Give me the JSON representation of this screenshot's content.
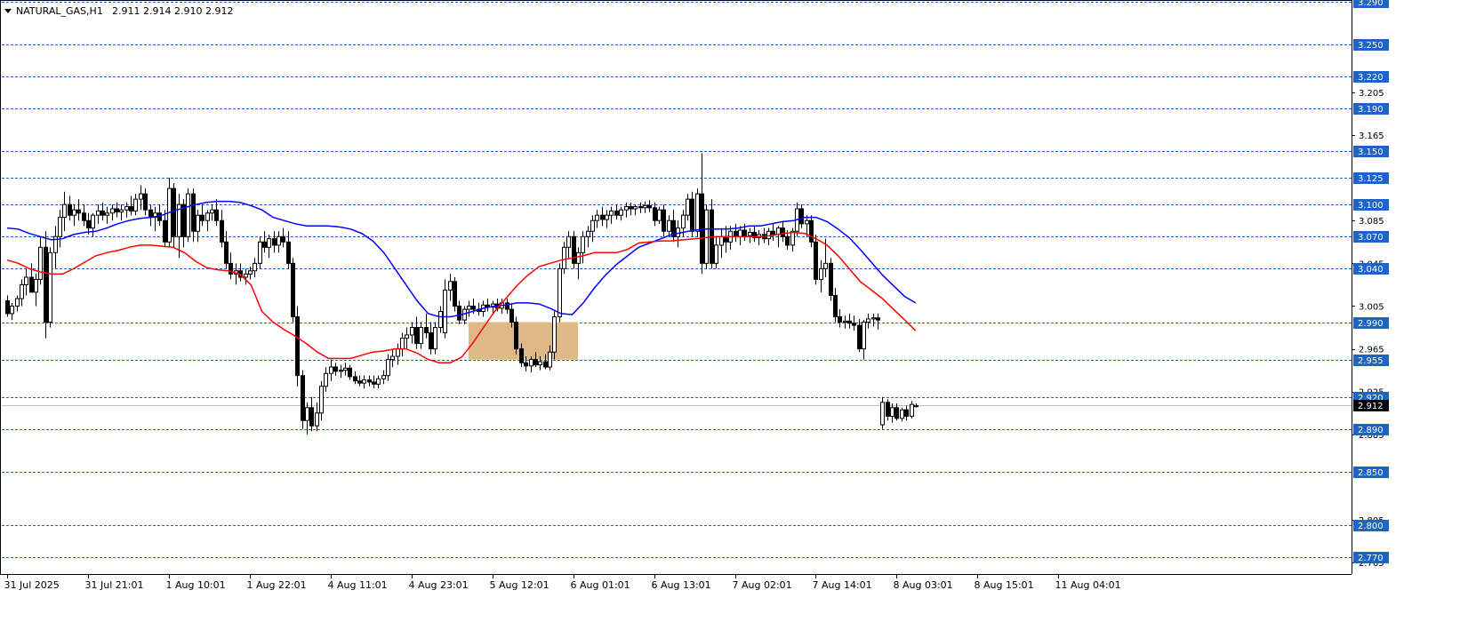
{
  "chart_data": {
    "type": "candlestick",
    "header": {
      "symbol": "NATURAL_GAS,H1",
      "ohlc": "2.911 2.914 2.910 2.912"
    },
    "y_axis": {
      "range": [
        2.7544,
        3.2913
      ],
      "scale_labels": [
        "3.205",
        "3.165",
        "3.085",
        "3.045",
        "3.005",
        "2.965",
        "2.925",
        "2.885",
        "2.805",
        "2.765"
      ],
      "levels": [
        "3.290",
        "3.250",
        "3.220",
        "3.190",
        "3.150",
        "3.125",
        "3.100",
        "3.070",
        "3.040",
        "2.990",
        "2.955",
        "2.920",
        "2.890",
        "2.850",
        "2.800",
        "2.770"
      ],
      "current_price": "2.912"
    },
    "x_axis": {
      "labels": [
        "31 Jul 2025",
        "31 Jul 21:01",
        "1 Aug 10:01",
        "1 Aug 22:01",
        "4 Aug 11:01",
        "4 Aug 23:01",
        "5 Aug 12:01",
        "6 Aug 01:01",
        "6 Aug 13:01",
        "7 Aug 02:01",
        "7 Aug 14:01",
        "8 Aug 03:01",
        "8 Aug 15:01",
        "11 Aug 04:01"
      ]
    },
    "zone": {
      "from_bar": 97,
      "to_bar": 120,
      "low": 2.955,
      "high": 2.99,
      "color": "#deb887"
    },
    "colors": {
      "fast_ma": "#0000ff",
      "slow_ma": "#ff0000",
      "level_line": "#1e63c8",
      "bull": "#ffffff",
      "bear": "#000000"
    },
    "ohlc": [
      [
        3.01,
        3.015,
        2.995,
        2.998
      ],
      [
        2.998,
        3.008,
        2.992,
        3.005
      ],
      [
        3.005,
        3.015,
        3.0,
        3.012
      ],
      [
        3.012,
        3.03,
        3.005,
        3.025
      ],
      [
        3.025,
        3.04,
        3.015,
        3.032
      ],
      [
        3.032,
        3.045,
        3.02,
        3.018
      ],
      [
        3.018,
        3.035,
        3.005,
        3.03
      ],
      [
        3.03,
        3.07,
        3.025,
        3.06
      ],
      [
        3.06,
        3.075,
        2.975,
        2.99
      ],
      [
        2.99,
        3.06,
        2.985,
        3.055
      ],
      [
        3.055,
        3.08,
        3.04,
        3.07
      ],
      [
        3.07,
        3.095,
        3.06,
        3.088
      ],
      [
        3.088,
        3.112,
        3.075,
        3.1
      ],
      [
        3.1,
        3.108,
        3.085,
        3.09
      ],
      [
        3.09,
        3.1,
        3.08,
        3.095
      ],
      [
        3.095,
        3.105,
        3.085,
        3.092
      ],
      [
        3.092,
        3.1,
        3.08,
        3.085
      ],
      [
        3.085,
        3.092,
        3.072,
        3.078
      ],
      [
        3.078,
        3.092,
        3.07,
        3.09
      ],
      [
        3.09,
        3.1,
        3.082,
        3.094
      ],
      [
        3.094,
        3.102,
        3.085,
        3.09
      ],
      [
        3.09,
        3.098,
        3.082,
        3.092
      ],
      [
        3.092,
        3.1,
        3.085,
        3.096
      ],
      [
        3.096,
        3.102,
        3.088,
        3.093
      ],
      [
        3.093,
        3.1,
        3.085,
        3.095
      ],
      [
        3.095,
        3.102,
        3.088,
        3.098
      ],
      [
        3.098,
        3.108,
        3.09,
        3.094
      ],
      [
        3.094,
        3.11,
        3.09,
        3.105
      ],
      [
        3.105,
        3.118,
        3.095,
        3.11
      ],
      [
        3.11,
        3.115,
        3.09,
        3.095
      ],
      [
        3.095,
        3.1,
        3.08,
        3.088
      ],
      [
        3.088,
        3.098,
        3.075,
        3.092
      ],
      [
        3.092,
        3.1,
        3.08,
        3.085
      ],
      [
        3.085,
        3.095,
        3.06,
        3.065
      ],
      [
        3.065,
        3.125,
        3.06,
        3.115
      ],
      [
        3.115,
        3.12,
        3.06,
        3.07
      ],
      [
        3.07,
        3.11,
        3.05,
        3.1
      ],
      [
        3.1,
        3.105,
        3.06,
        3.07
      ],
      [
        3.07,
        3.115,
        3.065,
        3.11
      ],
      [
        3.11,
        3.115,
        3.065,
        3.075
      ],
      [
        3.075,
        3.095,
        3.065,
        3.09
      ],
      [
        3.09,
        3.1,
        3.08,
        3.085
      ],
      [
        3.085,
        3.095,
        3.075,
        3.092
      ],
      [
        3.092,
        3.1,
        3.085,
        3.095
      ],
      [
        3.095,
        3.105,
        3.08,
        3.085
      ],
      [
        3.085,
        3.095,
        3.06,
        3.065
      ],
      [
        3.065,
        3.075,
        3.04,
        3.045
      ],
      [
        3.045,
        3.055,
        3.03,
        3.035
      ],
      [
        3.035,
        3.045,
        3.025,
        3.038
      ],
      [
        3.038,
        3.045,
        3.028,
        3.032
      ],
      [
        3.032,
        3.04,
        3.025,
        3.035
      ],
      [
        3.035,
        3.042,
        3.03,
        3.038
      ],
      [
        3.038,
        3.05,
        3.032,
        3.045
      ],
      [
        3.045,
        3.07,
        3.04,
        3.065
      ],
      [
        3.065,
        3.075,
        3.055,
        3.06
      ],
      [
        3.06,
        3.072,
        3.05,
        3.068
      ],
      [
        3.068,
        3.075,
        3.055,
        3.062
      ],
      [
        3.062,
        3.075,
        3.055,
        3.07
      ],
      [
        3.07,
        3.078,
        3.06,
        3.065
      ],
      [
        3.065,
        3.075,
        3.04,
        3.045
      ],
      [
        3.045,
        3.05,
        2.99,
        2.995
      ],
      [
        2.995,
        3.005,
        2.93,
        2.94
      ],
      [
        2.94,
        2.945,
        2.89,
        2.898
      ],
      [
        2.898,
        2.915,
        2.885,
        2.91
      ],
      [
        2.91,
        2.92,
        2.888,
        2.893
      ],
      [
        2.893,
        2.915,
        2.888,
        2.905
      ],
      [
        2.905,
        2.935,
        2.898,
        2.93
      ],
      [
        2.93,
        2.948,
        2.925,
        2.942
      ],
      [
        2.942,
        2.955,
        2.935,
        2.948
      ],
      [
        2.948,
        2.952,
        2.94,
        2.944
      ],
      [
        2.944,
        2.95,
        2.938,
        2.945
      ],
      [
        2.945,
        2.952,
        2.94,
        2.947
      ],
      [
        2.947,
        2.95,
        2.936,
        2.939
      ],
      [
        2.939,
        2.944,
        2.932,
        2.935
      ],
      [
        2.935,
        2.94,
        2.93,
        2.933
      ],
      [
        2.933,
        2.94,
        2.928,
        2.936
      ],
      [
        2.936,
        2.94,
        2.93,
        2.934
      ],
      [
        2.934,
        2.94,
        2.928,
        2.932
      ],
      [
        2.932,
        2.94,
        2.928,
        2.937
      ],
      [
        2.937,
        2.945,
        2.932,
        2.94
      ],
      [
        2.94,
        2.96,
        2.935,
        2.955
      ],
      [
        2.955,
        2.965,
        2.948,
        2.958
      ],
      [
        2.958,
        2.97,
        2.95,
        2.965
      ],
      [
        2.965,
        2.98,
        2.958,
        2.975
      ],
      [
        2.975,
        2.985,
        2.965,
        2.978
      ],
      [
        2.978,
        2.99,
        2.97,
        2.985
      ],
      [
        2.985,
        2.995,
        2.965,
        2.97
      ],
      [
        2.97,
        2.99,
        2.965,
        2.985
      ],
      [
        2.985,
        2.998,
        2.975,
        2.98
      ],
      [
        2.98,
        2.99,
        2.96,
        2.965
      ],
      [
        2.965,
        2.99,
        2.96,
        2.985
      ],
      [
        2.985,
        3.005,
        2.98,
        3.0
      ],
      [
        2.98,
        3.03,
        2.975,
        3.02
      ],
      [
        3.02,
        3.035,
        3.01,
        3.028
      ],
      [
        3.028,
        3.032,
        3.0,
        3.005
      ],
      [
        3.005,
        3.01,
        2.988,
        2.992
      ],
      [
        2.992,
        3.005,
        2.988,
        3.002
      ],
      [
        3.002,
        3.01,
        2.995,
        3.005
      ],
      [
        3.005,
        3.012,
        2.998,
        3.002
      ],
      [
        3.002,
        3.008,
        2.996,
        3.0
      ],
      [
        3.0,
        3.01,
        2.995,
        3.006
      ],
      [
        3.006,
        3.012,
        3.0,
        3.004
      ],
      [
        3.004,
        3.01,
        2.998,
        3.007
      ],
      [
        3.007,
        3.012,
        3.0,
        3.003
      ],
      [
        3.003,
        3.012,
        2.998,
        3.008
      ],
      [
        3.008,
        3.012,
        2.998,
        3.002
      ],
      [
        3.002,
        3.008,
        2.985,
        2.99
      ],
      [
        2.99,
        2.995,
        2.96,
        2.965
      ],
      [
        2.965,
        2.97,
        2.948,
        2.952
      ],
      [
        2.952,
        2.958,
        2.944,
        2.949
      ],
      [
        2.949,
        2.958,
        2.943,
        2.955
      ],
      [
        2.955,
        2.962,
        2.948,
        2.95
      ],
      [
        2.95,
        2.958,
        2.945,
        2.953
      ],
      [
        2.953,
        2.96,
        2.946,
        2.948
      ],
      [
        2.948,
        2.968,
        2.945,
        2.962
      ],
      [
        2.962,
        3.0,
        2.955,
        2.995
      ],
      [
        2.995,
        3.045,
        2.99,
        3.04
      ],
      [
        3.04,
        3.065,
        3.035,
        3.06
      ],
      [
        3.06,
        3.075,
        3.05,
        3.07
      ],
      [
        3.07,
        3.075,
        3.04,
        3.045
      ],
      [
        3.045,
        3.06,
        3.03,
        3.055
      ],
      [
        3.055,
        3.075,
        3.045,
        3.07
      ],
      [
        3.07,
        3.08,
        3.06,
        3.075
      ],
      [
        3.075,
        3.09,
        3.065,
        3.085
      ],
      [
        3.085,
        3.095,
        3.078,
        3.09
      ],
      [
        3.09,
        3.098,
        3.08,
        3.086
      ],
      [
        3.086,
        3.095,
        3.078,
        3.09
      ],
      [
        3.09,
        3.098,
        3.082,
        3.094
      ],
      [
        3.094,
        3.1,
        3.086,
        3.09
      ],
      [
        3.09,
        3.098,
        3.085,
        3.095
      ],
      [
        3.095,
        3.102,
        3.088,
        3.098
      ],
      [
        3.098,
        3.102,
        3.09,
        3.096
      ],
      [
        3.096,
        3.1,
        3.09,
        3.098
      ],
      [
        3.098,
        3.102,
        3.092,
        3.097
      ],
      [
        3.097,
        3.103,
        3.092,
        3.099
      ],
      [
        3.099,
        3.104,
        3.093,
        3.097
      ],
      [
        3.097,
        3.102,
        3.08,
        3.085
      ],
      [
        3.085,
        3.098,
        3.082,
        3.095
      ],
      [
        3.095,
        3.1,
        3.07,
        3.075
      ],
      [
        3.075,
        3.09,
        3.07,
        3.085
      ],
      [
        3.085,
        3.095,
        3.065,
        3.07
      ],
      [
        3.07,
        3.085,
        3.06,
        3.078
      ],
      [
        3.078,
        3.095,
        3.07,
        3.09
      ],
      [
        3.09,
        3.11,
        3.085,
        3.105
      ],
      [
        3.105,
        3.112,
        3.07,
        3.075
      ],
      [
        3.075,
        3.115,
        3.07,
        3.11
      ],
      [
        3.11,
        3.148,
        3.035,
        3.045
      ],
      [
        3.045,
        3.1,
        3.04,
        3.095
      ],
      [
        3.095,
        3.105,
        3.04,
        3.045
      ],
      [
        3.045,
        3.07,
        3.04,
        3.062
      ],
      [
        3.062,
        3.078,
        3.05,
        3.07
      ],
      [
        3.07,
        3.08,
        3.055,
        3.065
      ],
      [
        3.065,
        3.08,
        3.058,
        3.075
      ],
      [
        3.075,
        3.082,
        3.065,
        3.07
      ],
      [
        3.07,
        3.08,
        3.062,
        3.076
      ],
      [
        3.076,
        3.082,
        3.066,
        3.071
      ],
      [
        3.071,
        3.078,
        3.064,
        3.074
      ],
      [
        3.074,
        3.08,
        3.065,
        3.069
      ],
      [
        3.069,
        3.076,
        3.062,
        3.072
      ],
      [
        3.072,
        3.078,
        3.064,
        3.068
      ],
      [
        3.068,
        3.078,
        3.062,
        3.075
      ],
      [
        3.075,
        3.082,
        3.066,
        3.072
      ],
      [
        3.072,
        3.08,
        3.06,
        3.078
      ],
      [
        3.078,
        3.084,
        3.065,
        3.07
      ],
      [
        3.07,
        3.076,
        3.058,
        3.062
      ],
      [
        3.062,
        3.078,
        3.056,
        3.075
      ],
      [
        3.075,
        3.102,
        3.07,
        3.096
      ],
      [
        3.096,
        3.1,
        3.078,
        3.082
      ],
      [
        3.082,
        3.09,
        3.07,
        3.085
      ],
      [
        3.085,
        3.09,
        3.06,
        3.065
      ],
      [
        3.065,
        3.072,
        3.025,
        3.03
      ],
      [
        3.03,
        3.048,
        3.018,
        3.04
      ],
      [
        3.04,
        3.068,
        3.032,
        3.045
      ],
      [
        3.045,
        3.05,
        3.01,
        3.015
      ],
      [
        3.015,
        3.022,
        2.99,
        2.995
      ],
      [
        2.995,
        3.002,
        2.985,
        2.99
      ],
      [
        2.99,
        2.996,
        2.984,
        2.991
      ],
      [
        2.991,
        2.998,
        2.984,
        2.989
      ],
      [
        2.989,
        2.996,
        2.982,
        2.987
      ],
      [
        2.987,
        2.993,
        2.962,
        2.965
      ],
      [
        2.965,
        2.992,
        2.955,
        2.99
      ],
      [
        2.99,
        2.998,
        2.984,
        2.993
      ],
      [
        2.993,
        2.998,
        2.986,
        2.994
      ],
      [
        2.994,
        2.998,
        2.983,
        2.992
      ],
      [
        2.894,
        2.92,
        2.89,
        2.915
      ],
      [
        2.915,
        2.918,
        2.898,
        2.902
      ],
      [
        2.902,
        2.914,
        2.896,
        2.91
      ],
      [
        2.91,
        2.914,
        2.898,
        2.9
      ],
      [
        2.9,
        2.91,
        2.897,
        2.908
      ],
      [
        2.908,
        2.912,
        2.898,
        2.902
      ],
      [
        2.902,
        2.916,
        2.9,
        2.913
      ],
      [
        2.911,
        2.914,
        2.91,
        2.912
      ]
    ],
    "fast_ma": [
      3.078,
      3.077,
      3.073,
      3.07,
      3.067,
      3.068,
      3.072,
      3.074,
      3.075,
      3.078,
      3.082,
      3.085,
      3.087,
      3.088,
      3.09,
      3.094,
      3.097,
      3.1,
      3.102,
      3.103,
      3.103,
      3.102,
      3.099,
      3.095,
      3.088,
      3.085,
      3.082,
      3.08,
      3.08,
      3.08,
      3.079,
      3.077,
      3.073,
      3.066,
      3.055,
      3.04,
      3.025,
      3.01,
      2.998,
      2.995,
      2.995,
      2.997,
      3.0,
      3.003,
      3.005,
      3.006,
      3.008,
      3.008,
      3.007,
      3.003,
      2.998,
      2.997,
      3.008,
      3.022,
      3.034,
      3.044,
      3.052,
      3.06,
      3.064,
      3.068,
      3.072,
      3.074,
      3.076,
      3.077,
      3.077,
      3.077,
      3.078,
      3.08,
      3.08,
      3.082,
      3.084,
      3.085,
      3.088,
      3.088,
      3.084,
      3.077,
      3.069,
      3.058,
      3.046,
      3.034,
      3.024,
      3.014,
      3.008
    ],
    "fast_ma_start": 0,
    "slow_ma": [
      3.048,
      3.045,
      3.04,
      3.037,
      3.035,
      3.035,
      3.04,
      3.046,
      3.052,
      3.055,
      3.057,
      3.06,
      3.062,
      3.062,
      3.061,
      3.06,
      3.055,
      3.047,
      3.041,
      3.039,
      3.038,
      3.035,
      3.025,
      3.0,
      2.99,
      2.983,
      2.977,
      2.97,
      2.962,
      2.956,
      2.956,
      2.956,
      2.959,
      2.962,
      2.963,
      2.965,
      2.965,
      2.961,
      2.955,
      2.952,
      2.952,
      2.957,
      2.97,
      2.985,
      3.0,
      3.012,
      3.024,
      3.034,
      3.042,
      3.045,
      3.048,
      3.05,
      3.052,
      3.055,
      3.055,
      3.055,
      3.058,
      3.064,
      3.065,
      3.066,
      3.066,
      3.067,
      3.068,
      3.069,
      3.07,
      3.07,
      3.07,
      3.07,
      3.07,
      3.071,
      3.073,
      3.074,
      3.073,
      3.068,
      3.062,
      3.052,
      3.04,
      3.028,
      3.02,
      3.012,
      3.002,
      2.992,
      2.982
    ],
    "slow_ma_start": 0
  }
}
